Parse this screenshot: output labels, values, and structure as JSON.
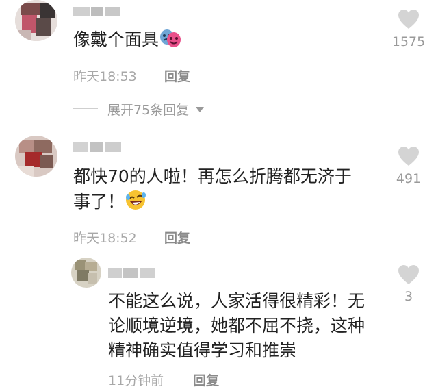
{
  "comments": [
    {
      "text": "像戴个面具",
      "time": "昨天18:53",
      "reply_label": "回复",
      "likes": "1575",
      "emoji": "performing-arts-masks"
    },
    {
      "text": "都快70的人啦！再怎么折腾都无济于事了！",
      "text_line1": "都快70的人啦！再怎么折腾都无济于",
      "text_line2": "事了！",
      "time": "昨天18:52",
      "reply_label": "回复",
      "likes": "491",
      "emoji": "rolling-on-floor-laughing"
    }
  ],
  "expand_replies": {
    "label": "展开75条回复"
  },
  "reply": {
    "text_line1": "不能这么说，人家活得很精彩！无",
    "text_line2": "论顺境逆境，她都不屈不挠，这种",
    "text_line3": "精神确实值得学习和推崇",
    "time": "11分钟前",
    "reply_label": "回复",
    "likes": "3"
  },
  "colors": {
    "heart": "#d4d4d4",
    "meta": "#a8a8a8",
    "text": "#222222"
  }
}
